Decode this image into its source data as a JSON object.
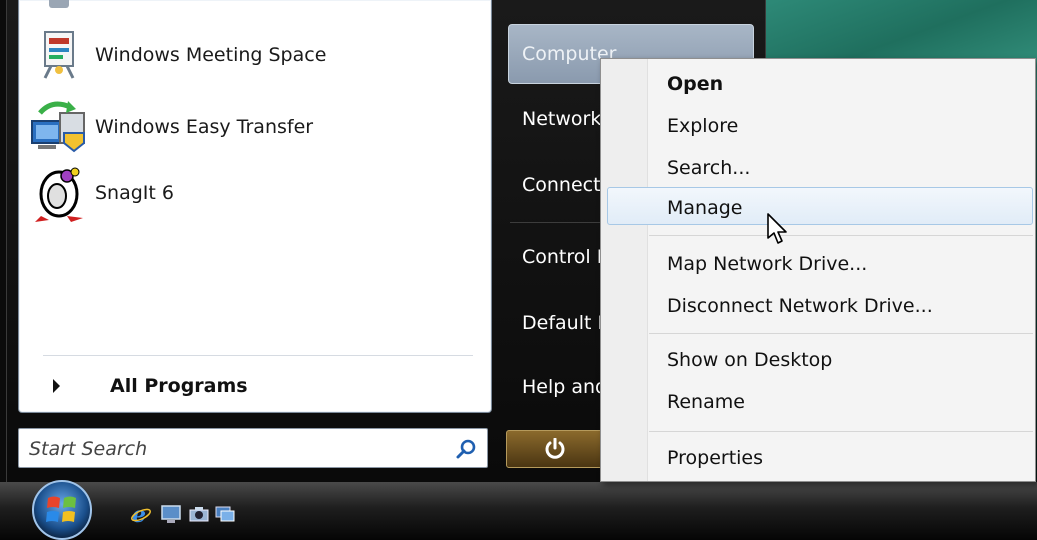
{
  "start_menu": {
    "programs": [
      {
        "label": "Windows Meeting Space",
        "icon": "meeting-space-icon"
      },
      {
        "label": "Windows Easy Transfer",
        "icon": "easy-transfer-icon"
      },
      {
        "label": "SnagIt 6",
        "icon": "snagit-icon"
      }
    ],
    "all_programs_label": "All Programs",
    "search": {
      "placeholder": "Start Search"
    },
    "right_items": [
      {
        "label": "Computer"
      },
      {
        "label": "Network"
      },
      {
        "label": "Connect To"
      },
      {
        "label": "Control Panel"
      },
      {
        "label": "Default Programs"
      },
      {
        "label": "Help and Support"
      }
    ]
  },
  "context_menu": {
    "items": [
      {
        "label": "Open",
        "bold": true
      },
      {
        "label": "Explore"
      },
      {
        "label": "Search..."
      },
      {
        "label": "Manage",
        "highlighted": true
      },
      {
        "label": "Map Network Drive..."
      },
      {
        "label": "Disconnect Network Drive..."
      },
      {
        "label": "Show on Desktop"
      },
      {
        "label": "Rename"
      },
      {
        "label": "Properties"
      }
    ]
  },
  "taskbar": {
    "quick_launch": [
      "ie-icon",
      "show-desktop-icon",
      "camera-icon",
      "switch-windows-icon"
    ]
  },
  "colors": {
    "menu_highlight_border": "#a7c8e6",
    "start_menu_bg": "#0a0a0a",
    "context_menu_bg": "#f4f4f4"
  }
}
